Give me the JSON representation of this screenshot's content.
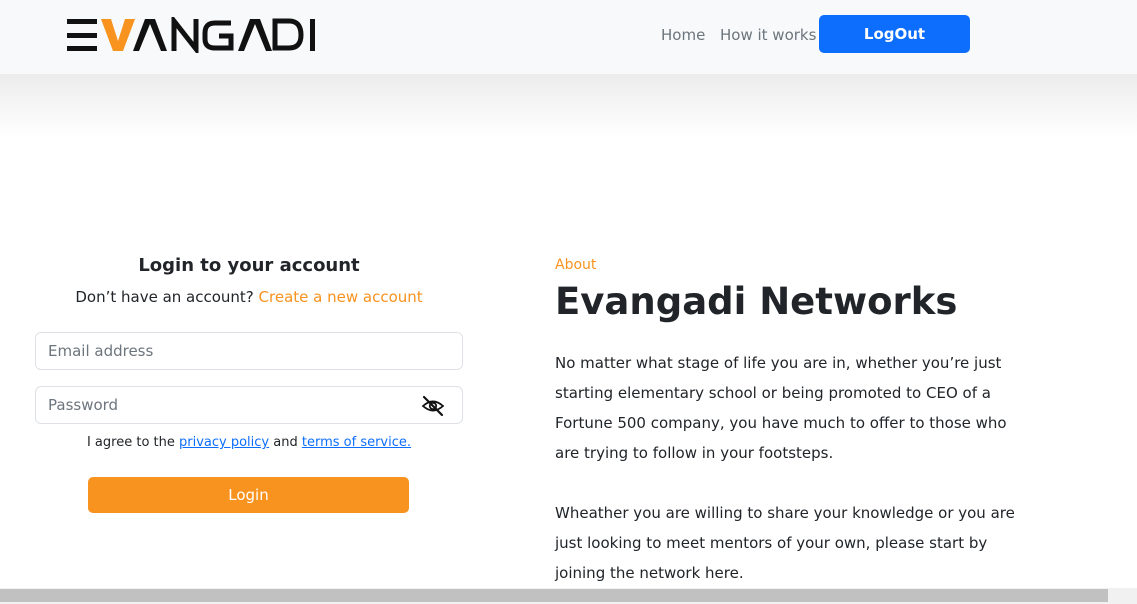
{
  "header": {
    "brand": "EVANGADI",
    "nav": {
      "home": "Home",
      "how_it_works": "How it works"
    },
    "logout_label": "LogOut"
  },
  "login": {
    "title": "Login to your account",
    "no_account_text": "Don’t have an account?",
    "create_account_link": "Create a new account",
    "email_placeholder": "Email address",
    "password_placeholder": "Password",
    "agree_prefix": "I agree to the",
    "privacy_link": "privacy policy",
    "agree_and": "and",
    "terms_link": "terms of service.",
    "submit_label": "Login"
  },
  "about": {
    "label": "About",
    "title": "Evangadi Networks",
    "paragraph1": "No matter what stage of life you are in, whether you’re just starting elementary school or being promoted to CEO of a Fortune 500 company, you have much to offer to those who are trying to follow in your footsteps.",
    "paragraph2": "Wheather you are willing to share your knowledge or you are just looking to meet mentors of your own, please start by joining the network here."
  },
  "colors": {
    "accent": "#f7931e",
    "primary": "#0d6efd",
    "text": "#212529"
  },
  "icons": {
    "password_toggle": "eye-slash-icon"
  }
}
